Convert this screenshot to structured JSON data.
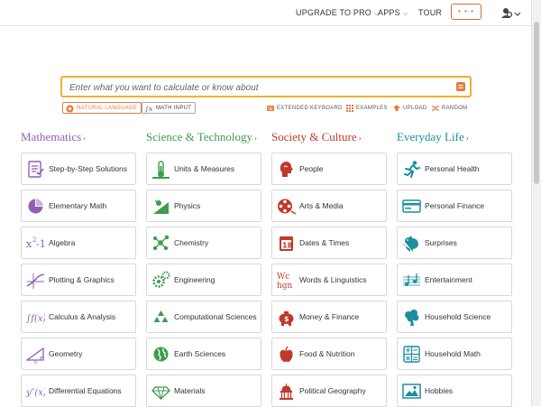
{
  "nav": {
    "upgrade": "UPGRADE TO PRO",
    "apps": "APPS",
    "tour": "TOUR",
    "more": "• • •"
  },
  "search": {
    "placeholder": "Enter what you want to calculate or know about"
  },
  "modes": {
    "natural_language": "NATURAL LANGUAGE",
    "math_input": "MATH INPUT"
  },
  "tools": {
    "extended_keyboard": "EXTENDED KEYBOARD",
    "examples": "EXAMPLES",
    "upload": "UPLOAD",
    "random": "RANDOM"
  },
  "colors": {
    "accent": "#e8793f",
    "search_border": "#f0b02e",
    "mathematics": "#8f5fb5",
    "science": "#3e9c4b",
    "society": "#c0392b",
    "everyday": "#1a8f9e"
  },
  "categories": [
    {
      "title": "Mathematics",
      "items": [
        {
          "label": "Step-by-Step Solutions",
          "icon": "step-by-step-icon"
        },
        {
          "label": "Elementary Math",
          "icon": "pie-chart-icon"
        },
        {
          "label": "Algebra",
          "icon": "algebra-icon"
        },
        {
          "label": "Plotting & Graphics",
          "icon": "plot-icon"
        },
        {
          "label": "Calculus & Analysis",
          "icon": "integral-icon"
        },
        {
          "label": "Geometry",
          "icon": "triangle-icon"
        },
        {
          "label": "Differential Equations",
          "icon": "derivative-icon"
        }
      ]
    },
    {
      "title": "Science & Technology",
      "items": [
        {
          "label": "Units & Measures",
          "icon": "thermometer-icon"
        },
        {
          "label": "Physics",
          "icon": "physics-icon"
        },
        {
          "label": "Chemistry",
          "icon": "molecule-icon"
        },
        {
          "label": "Engineering",
          "icon": "gears-icon"
        },
        {
          "label": "Computational Sciences",
          "icon": "fractal-icon"
        },
        {
          "label": "Earth Sciences",
          "icon": "globe-icon"
        },
        {
          "label": "Materials",
          "icon": "diamond-icon"
        }
      ]
    },
    {
      "title": "Society & Culture",
      "items": [
        {
          "label": "People",
          "icon": "person-head-icon"
        },
        {
          "label": "Arts & Media",
          "icon": "film-reel-icon"
        },
        {
          "label": "Dates & Times",
          "icon": "calendar-icon"
        },
        {
          "label": "Words & Linguistics",
          "icon": "letters-icon"
        },
        {
          "label": "Money & Finance",
          "icon": "piggy-bank-icon"
        },
        {
          "label": "Food & Nutrition",
          "icon": "apple-icon"
        },
        {
          "label": "Political Geography",
          "icon": "capitol-icon"
        }
      ]
    },
    {
      "title": "Everyday Life",
      "items": [
        {
          "label": "Personal Health",
          "icon": "runner-icon"
        },
        {
          "label": "Personal Finance",
          "icon": "credit-card-icon"
        },
        {
          "label": "Surprises",
          "icon": "chicken-icon"
        },
        {
          "label": "Entertainment",
          "icon": "music-icon"
        },
        {
          "label": "Household Science",
          "icon": "broccoli-icon"
        },
        {
          "label": "Household Math",
          "icon": "calculator-icon"
        },
        {
          "label": "Hobbies",
          "icon": "picture-icon"
        }
      ]
    }
  ]
}
